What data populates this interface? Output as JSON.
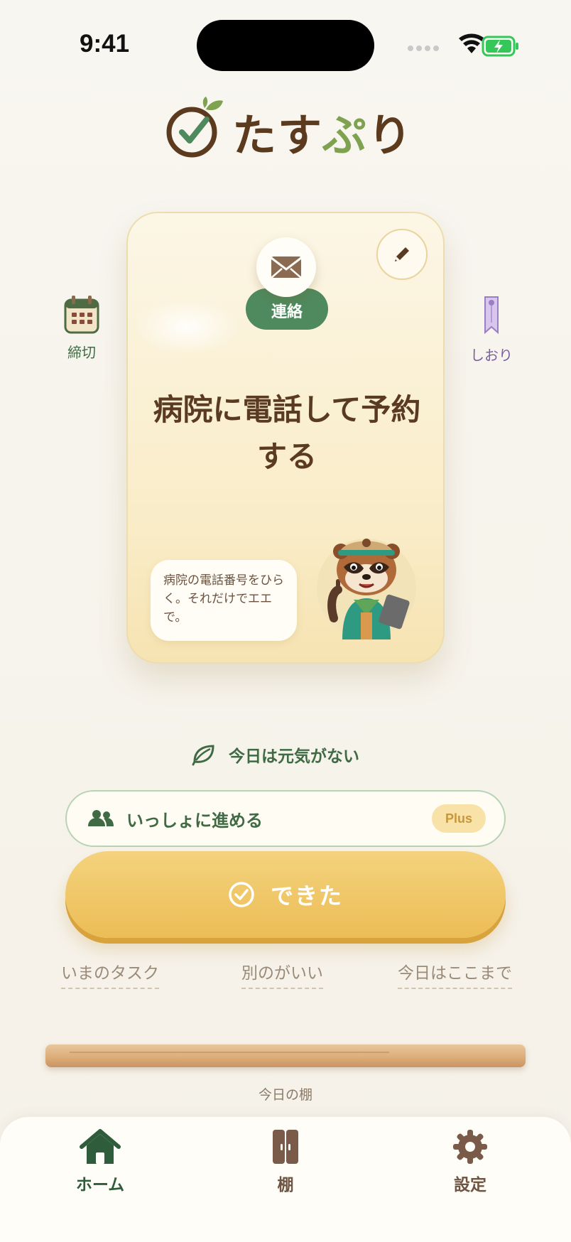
{
  "status": {
    "time": "9:41"
  },
  "app": {
    "logo_main": "たす",
    "logo_accent": "ぷ",
    "logo_end": "り"
  },
  "side": {
    "deadline_label": "締切",
    "bookmark_label": "しおり"
  },
  "card": {
    "category": "連絡",
    "title": "病院に電話して予約する",
    "hint": "病院の電話番号をひらく。それだけでエエで。"
  },
  "actions": {
    "low_energy": "今日は元気がない",
    "together": "いっしょに進める",
    "plus_badge": "Plus",
    "done": "できた",
    "current_task": "いまのタスク",
    "another": "別のがいい",
    "stop_today": "今日はここまで"
  },
  "shelf": {
    "label": "今日の棚"
  },
  "tabs": [
    {
      "label": "ホーム",
      "icon": "home-icon",
      "active": true
    },
    {
      "label": "棚",
      "icon": "cabinet-icon",
      "active": false
    },
    {
      "label": "設定",
      "icon": "gear-icon",
      "active": false
    }
  ],
  "colors": {
    "background": "#f7f4ec",
    "brand_brown": "#5b3a1e",
    "brand_green": "#4f8a5e",
    "accent_yellow": "#ecbd56",
    "card_bg": "#f9ecc7"
  }
}
